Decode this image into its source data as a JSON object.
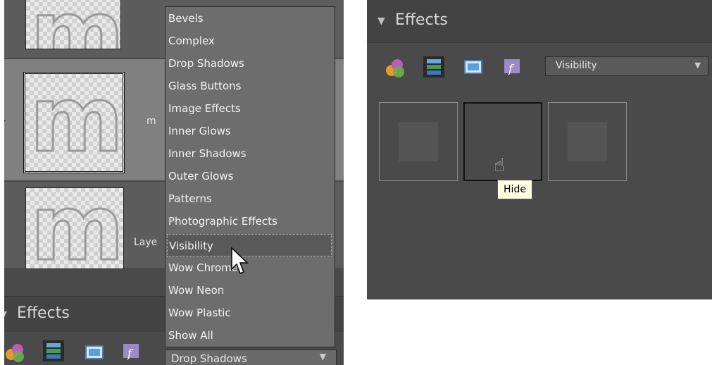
{
  "left_panel": {
    "layers": [
      {
        "name": ""
      },
      {
        "name": "m"
      },
      {
        "name": "Laye"
      }
    ],
    "dropdown_menu": {
      "items": [
        "Bevels",
        "Complex",
        "Drop Shadows",
        "Glass Buttons",
        "Image Effects",
        "Inner Glows",
        "Inner Shadows",
        "Outer Glows",
        "Patterns",
        "Photographic Effects",
        "Visibility",
        "Wow Chrome",
        "Wow Neon",
        "Wow Plastic",
        "Show All"
      ],
      "highlighted": "Visibility"
    },
    "effects_title": "Effects",
    "category_select": {
      "value": "Drop Shadows"
    }
  },
  "right_panel": {
    "effects_title": "Effects",
    "category_select": {
      "value": "Visibility"
    },
    "tooltip": "Hide"
  },
  "colors": {
    "panel_bg": "#4a4a4a",
    "menu_bg": "#6d6d6d",
    "tooltip_bg": "#ffffe1"
  }
}
